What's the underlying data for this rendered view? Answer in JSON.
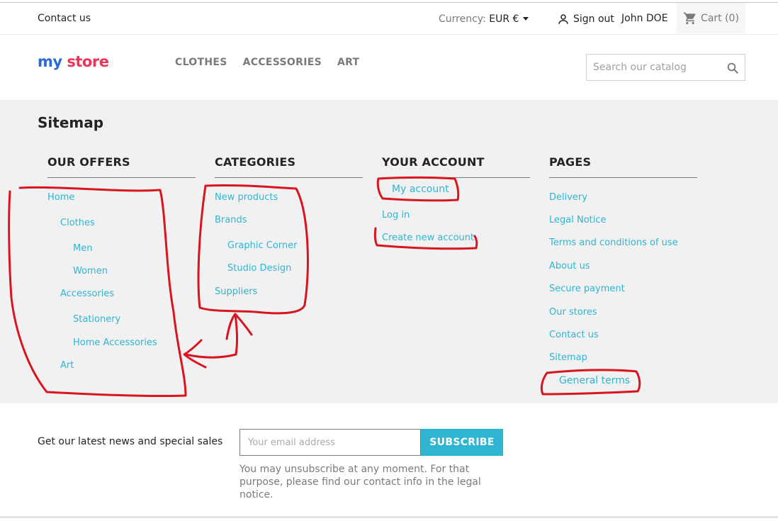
{
  "topbar": {
    "contact": "Contact us",
    "currency_label": "Currency:",
    "currency_value": "EUR €",
    "signout": "Sign out",
    "username": "John DOE",
    "cart": "Cart (0)"
  },
  "header": {
    "logo_part1": "my",
    "logo_part2": "store",
    "nav": [
      "CLOTHES",
      "ACCESSORIES",
      "ART"
    ],
    "search_placeholder": "Search our catalog"
  },
  "page_title": "Sitemap",
  "columns": {
    "offers": {
      "title": "OUR OFFERS",
      "links": [
        "Home",
        "Clothes",
        "Men",
        "Women",
        "Accessories",
        "Stationery",
        "Home Accessories",
        "Art"
      ]
    },
    "categories": {
      "title": "CATEGORIES",
      "links": [
        "New products",
        "Brands",
        "Graphic Corner",
        "Studio Design",
        "Suppliers"
      ]
    },
    "account": {
      "title": "YOUR ACCOUNT",
      "links": [
        "My account",
        "Log in",
        "Create new account"
      ]
    },
    "pages": {
      "title": "PAGES",
      "links": [
        "Delivery",
        "Legal Notice",
        "Terms and conditions of use",
        "About us",
        "Secure payment",
        "Our stores",
        "Contact us",
        "Sitemap",
        "General terms"
      ]
    }
  },
  "newsletter": {
    "label": "Get our latest news and special sales",
    "placeholder": "Your email address",
    "button": "SUBSCRIBE",
    "note": "You may unsubscribe at any moment. For that purpose, please find our contact info in the legal notice."
  },
  "colors": {
    "accent": "#2fb5d2",
    "annotation": "#d9141e"
  }
}
